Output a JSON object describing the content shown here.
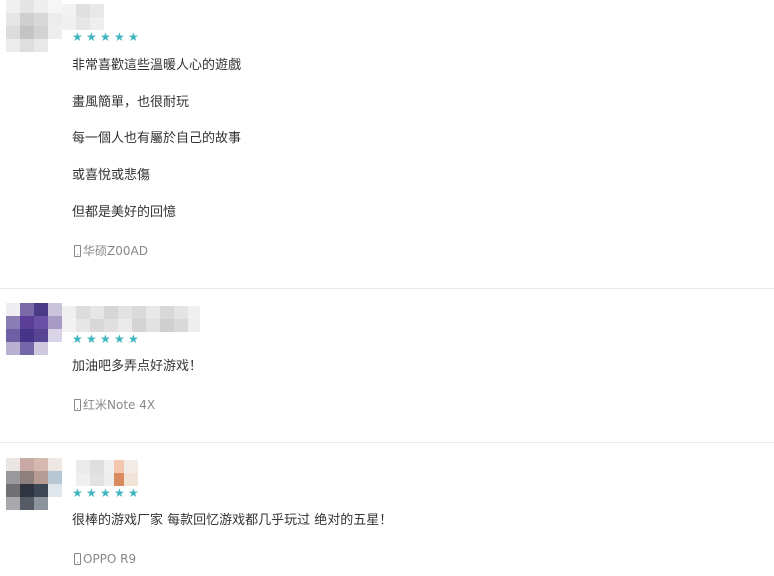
{
  "colors": {
    "star": "#3fb5c1",
    "text": "#333333",
    "device_text": "#888888",
    "divider": "#e8e8e8"
  },
  "star_glyph": "★",
  "reviews": [
    {
      "rating": 5,
      "lines": [
        "非常喜歡這些溫暖人心的遊戲",
        "畫風簡單，也很耐玩",
        "每一個人也有屬於自己的故事",
        "或喜悅或悲傷",
        "但都是美好的回憶"
      ],
      "device": "华硕Z00AD"
    },
    {
      "rating": 5,
      "lines": [
        "加油吧多弄点好游戏！"
      ],
      "device": "红米Note 4X"
    },
    {
      "rating": 5,
      "lines": [
        "很棒的游戏厂家 每款回忆游戏都几乎玩过 绝对的五星！"
      ],
      "device": "OPPO R9"
    }
  ]
}
